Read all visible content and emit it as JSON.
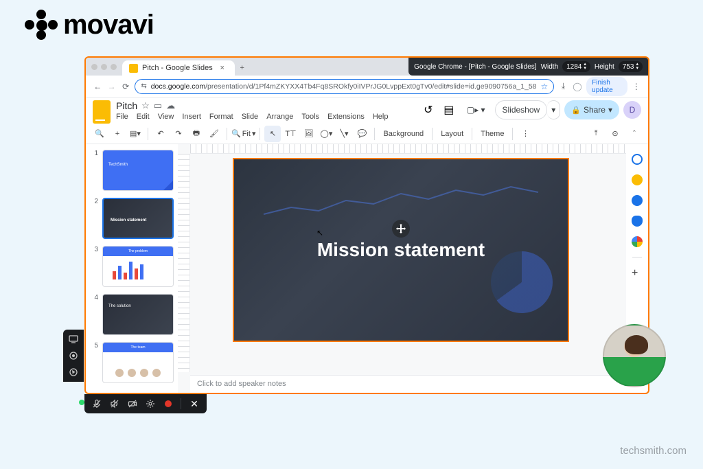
{
  "brand": {
    "name": "movavi"
  },
  "watermark": "techsmith.com",
  "tabstrip": {
    "tab_title": "Pitch - Google Slides",
    "chrome_caption": "Google Chrome - [Pitch - Google Slides]",
    "width_label": "Width",
    "width_value": "1284",
    "height_label": "Height",
    "height_value": "753"
  },
  "url": {
    "host": "docs.google.com",
    "path": "/presentation/d/1Pf4mZKYXX4Tb4Fq8SROkfy0iIVPrJG0LvppExt0gTv0/edit#slide=id.ge9090756a_1_58",
    "finish_update": "Finish update"
  },
  "doc": {
    "title": "Pitch",
    "menus": [
      "File",
      "Edit",
      "View",
      "Insert",
      "Format",
      "Slide",
      "Arrange",
      "Tools",
      "Extensions",
      "Help"
    ],
    "slideshow_label": "Slideshow",
    "share_label": "Share",
    "account_initial": "D"
  },
  "toolbar": {
    "zoom_label": "Fit",
    "bg_label": "Background",
    "layout_label": "Layout",
    "theme_label": "Theme"
  },
  "filmstrip": {
    "slides": [
      {
        "num": "1",
        "title": "TechSmith"
      },
      {
        "num": "2",
        "title": "Mission statement"
      },
      {
        "num": "3",
        "title": "The problem"
      },
      {
        "num": "4",
        "title": "The solution"
      },
      {
        "num": "5",
        "title": "The team"
      }
    ]
  },
  "canvas": {
    "slide_title": "Mission statement",
    "notes_placeholder": "Click to add speaker notes"
  }
}
